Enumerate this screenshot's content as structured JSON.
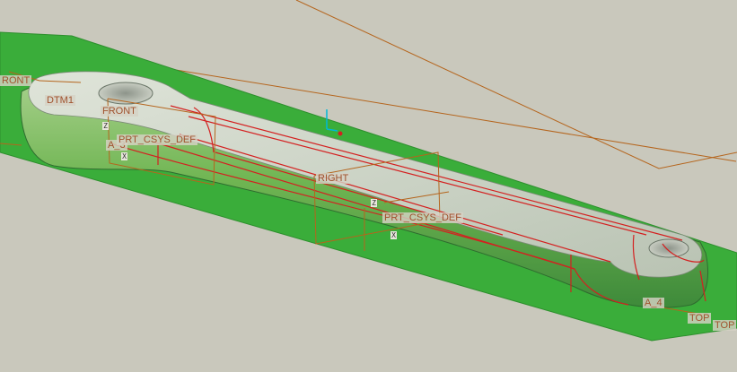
{
  "datum_labels": {
    "front_left": "RONT",
    "dtm1": "DTM1",
    "front": "FRONT",
    "a3": "A_3",
    "prt_csys_def_1": "PRT_CSYS_DEF",
    "right": "RIGHT",
    "prt_csys_def_2": "PRT_CSYS_DEF",
    "a4": "A_4",
    "top_1": "TOP",
    "top_2": "TOP"
  },
  "axis_tags": {
    "z1": "Z",
    "x1": "X",
    "z2": "Z",
    "x2": "X"
  },
  "colors": {
    "background": "#c9c8bc",
    "ground_plane": "#3aad3a",
    "part_edge": "#d42020",
    "datum_plane": "#b5651d",
    "datum_text": "#a0522d",
    "spin_center": "#00b8d8"
  }
}
